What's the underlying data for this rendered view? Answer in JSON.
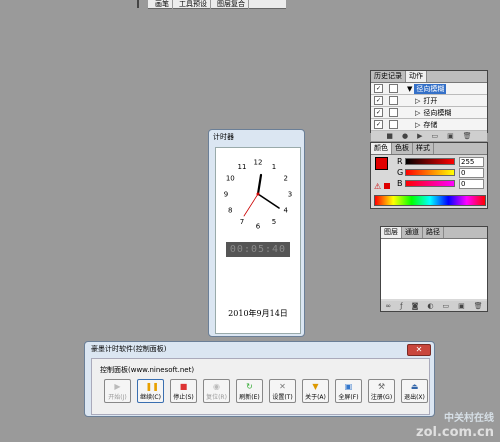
{
  "top_tabs": [
    "画笔",
    "工具预设",
    "图层复合"
  ],
  "history_panel": {
    "tabs": [
      "历史记录",
      "动作"
    ],
    "rows": [
      {
        "label": "径向模糊",
        "selected": true
      },
      {
        "label": "打开",
        "selected": false
      },
      {
        "label": "径向模糊",
        "selected": false
      },
      {
        "label": "存储",
        "selected": false
      }
    ]
  },
  "color_panel": {
    "tabs": [
      "颜色",
      "色板",
      "样式"
    ],
    "channels": [
      {
        "name": "R",
        "value": "255",
        "color": "#ff0000"
      },
      {
        "name": "G",
        "value": "0",
        "color": "#00aa00"
      },
      {
        "name": "B",
        "value": "0",
        "color": "#0000ff"
      }
    ]
  },
  "layers_panel": {
    "tabs": [
      "图层",
      "通道",
      "路径"
    ]
  },
  "timer_window": {
    "title": "计时器",
    "clock_numbers": [
      "12",
      "1",
      "2",
      "3",
      "4",
      "5",
      "6",
      "7",
      "8",
      "9",
      "10",
      "11"
    ],
    "digital": "00:05:40",
    "date": "2010年9月14日"
  },
  "control_window": {
    "title": "豪墨计时软件(控制面板)",
    "close_label": "✕",
    "panel_label": "控制面板(www.ninesoft.net)",
    "buttons": [
      {
        "label": "开始(J)",
        "icon": "play-icon",
        "enabled": false
      },
      {
        "label": "继续(C)",
        "icon": "pause-icon",
        "enabled": true
      },
      {
        "label": "停止(S)",
        "icon": "stop-icon",
        "enabled": true
      },
      {
        "label": "复位(R)",
        "icon": "reset-icon",
        "enabled": false
      },
      {
        "label": "刷新(E)",
        "icon": "refresh-icon",
        "enabled": true
      },
      {
        "label": "设置(T)",
        "icon": "tools-icon",
        "enabled": true
      },
      {
        "label": "关于(A)",
        "icon": "about-icon",
        "enabled": true
      },
      {
        "label": "全屏(F)",
        "icon": "fullscreen-icon",
        "enabled": true
      },
      {
        "label": "注册(G)",
        "icon": "register-icon",
        "enabled": true
      },
      {
        "label": "退出(X)",
        "icon": "exit-icon",
        "enabled": true
      }
    ]
  },
  "watermark": {
    "cn": "中关村在线",
    "en": "zol.com.cn"
  }
}
